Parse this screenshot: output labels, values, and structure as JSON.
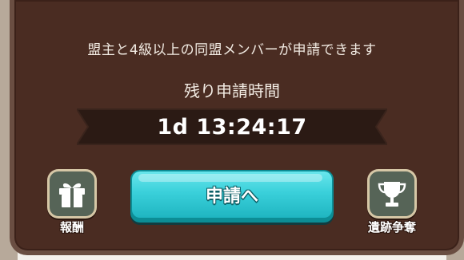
{
  "panel": {
    "notice": "盟主と4級以上の同盟メンバーが申請できます",
    "remaining_label": "残り申請時間",
    "timer": "1d 13:24:17"
  },
  "buttons": {
    "rewards_label": "報酬",
    "rewards_icon": "gift-icon",
    "apply_label": "申請へ",
    "ruins_label": "遺跡争奪",
    "ruins_icon": "trophy-icon"
  },
  "colors": {
    "panel_bg": "#4a2c22",
    "ribbon": "#2b1a14",
    "apply_button": "#3ad0da",
    "side_button": "#566457"
  }
}
